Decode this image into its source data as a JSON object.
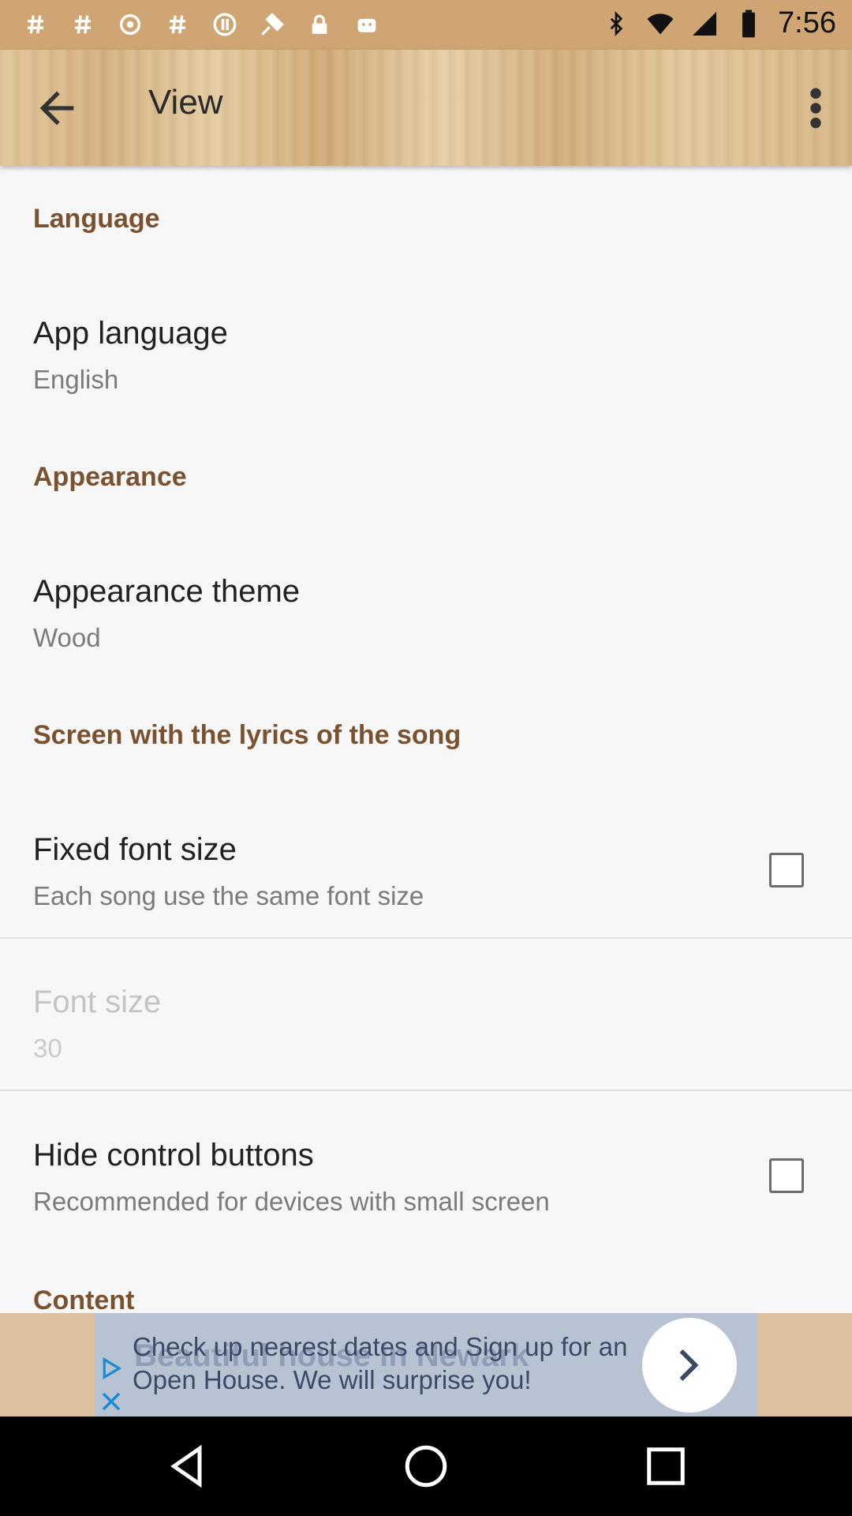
{
  "status_bar": {
    "time": "7:56",
    "left_icons": [
      "hash-icon",
      "hash-icon",
      "settings-icon",
      "hash-icon",
      "no-sync-icon",
      "fake-gps-icon",
      "lock-icon",
      "android-icon"
    ],
    "right_icons": [
      "bluetooth-icon",
      "wifi-icon",
      "signal-icon",
      "battery-icon"
    ]
  },
  "toolbar": {
    "title": "View"
  },
  "sections": {
    "language": {
      "header": "Language",
      "app_language": {
        "title": "App language",
        "summary": "English"
      }
    },
    "appearance": {
      "header": "Appearance",
      "theme": {
        "title": "Appearance theme",
        "summary": "Wood"
      }
    },
    "lyrics": {
      "header": "Screen with the lyrics of the song",
      "fixed_font": {
        "title": "Fixed font size",
        "summary": "Each song use the same font size",
        "checked": false
      },
      "font_size": {
        "title": "Font size",
        "summary": "30",
        "enabled": false
      },
      "hide_controls": {
        "title": "Hide control buttons",
        "summary": "Recommended for devices with small screen",
        "checked": false
      }
    },
    "content": {
      "header": "Content"
    }
  },
  "ad": {
    "background_text": "Beautiful house in Newark",
    "text": "Check up nearest dates and Sign up for an Open House. We will surprise you!"
  },
  "colors": {
    "category": "#7a5230",
    "toolbar_wood": "#d9b887",
    "background": "#f7f7f7"
  }
}
